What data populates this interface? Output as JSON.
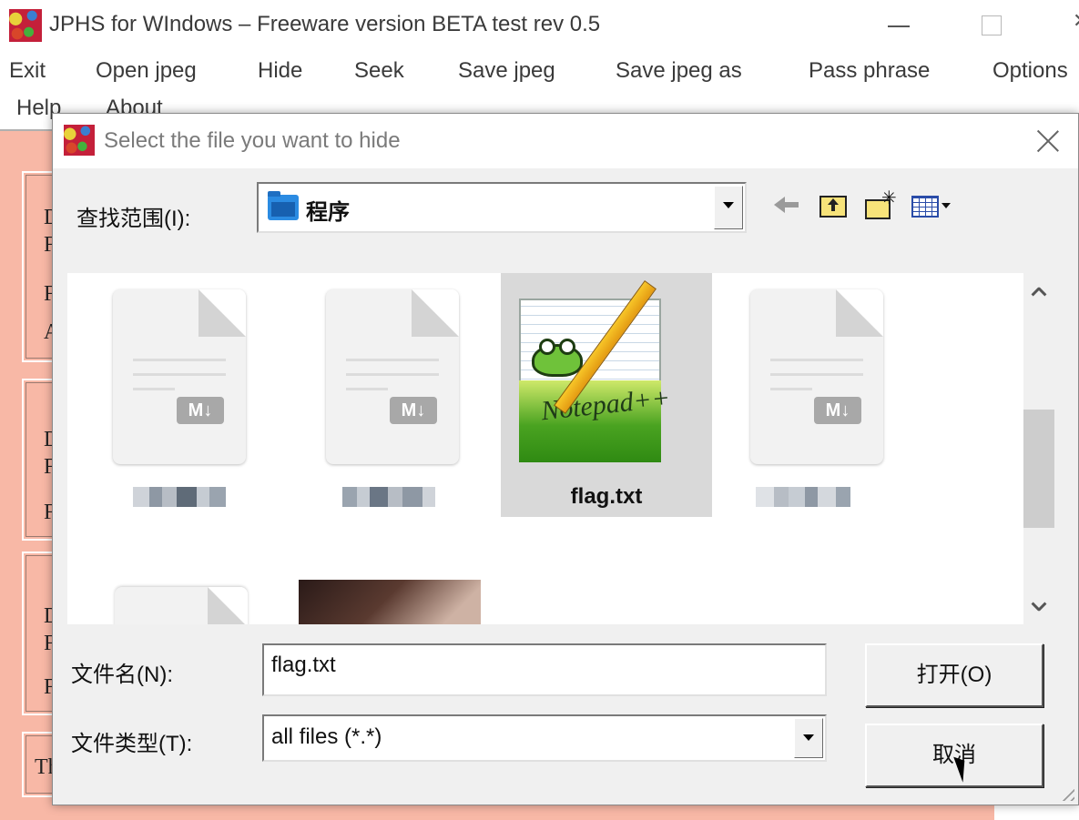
{
  "main_window": {
    "title": "JPHS for WIndows – Freeware version BETA test rev 0.5",
    "icon": "jphs-app-icon",
    "controls": {
      "minimize": "minimize-icon",
      "maximize": "maximize-icon",
      "close": "close-icon"
    }
  },
  "menubar": {
    "items": [
      "Exit",
      "Open jpeg",
      "Hide",
      "Seek",
      "Save jpeg",
      "Save jpeg as",
      "Pass phrase",
      "Options",
      "Help",
      "About"
    ]
  },
  "background_panel": {
    "color": "#f8b8a6",
    "group_labels": [
      "D",
      "F",
      "F",
      "A",
      "D",
      "F",
      "F",
      "D",
      "F",
      "F",
      "Th"
    ]
  },
  "dialog": {
    "title": "Select the file you want to hide",
    "look_in_label": "查找范围(I):",
    "look_in_value": "程序",
    "toolbar": [
      "back-arrow-icon",
      "up-one-level-icon",
      "new-folder-icon",
      "view-menu-icon"
    ],
    "files": [
      {
        "name": "",
        "icon": "markdown-file-icon",
        "badge": "M↓",
        "selected": false
      },
      {
        "name": "",
        "icon": "markdown-file-icon",
        "badge": "M↓",
        "selected": false
      },
      {
        "name": "flag.txt",
        "icon": "notepad-plus-plus-icon",
        "badge": "Notepad++",
        "selected": true
      },
      {
        "name": "",
        "icon": "markdown-file-icon",
        "badge": "M↓",
        "selected": false
      },
      {
        "name": "",
        "icon": "markdown-file-icon",
        "badge": "",
        "selected": false
      },
      {
        "name": "",
        "icon": "image-thumbnail",
        "badge": "",
        "selected": false
      }
    ],
    "file_name_label": "文件名(N):",
    "file_name_value": "flag.txt",
    "file_type_label": "文件类型(T):",
    "file_type_value": "all files (*.*)",
    "open_button": "打开(O)",
    "cancel_button": "取消"
  }
}
